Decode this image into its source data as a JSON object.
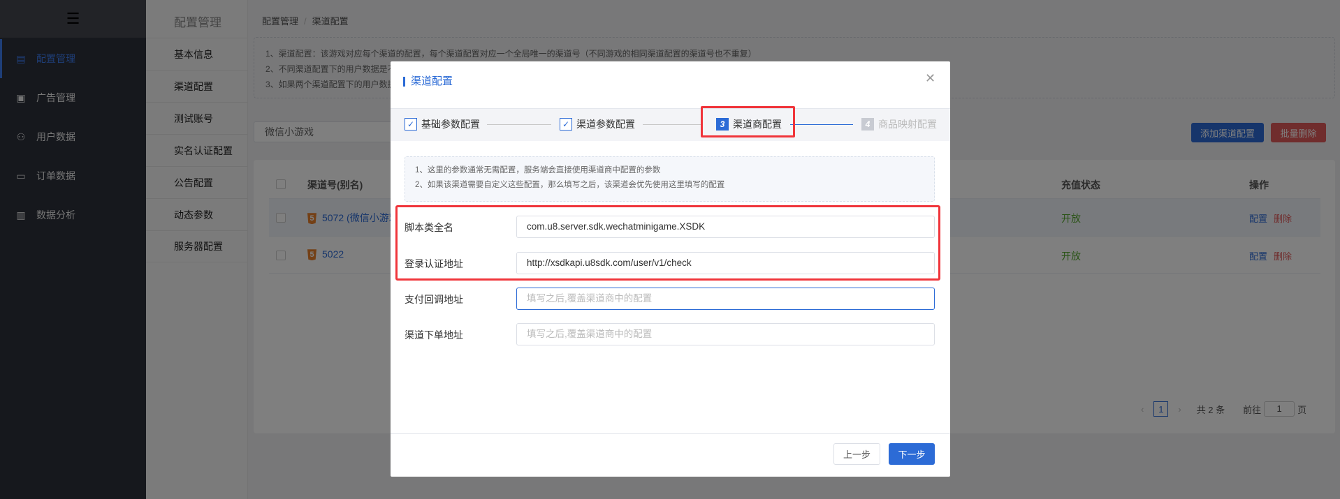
{
  "sidebar": {
    "toggle_icon": "menu-fold-icon",
    "items": [
      {
        "label": "配置管理",
        "icon": "config-icon",
        "active": true
      },
      {
        "label": "广告管理",
        "icon": "ad-icon"
      },
      {
        "label": "用户数据",
        "icon": "users-icon"
      },
      {
        "label": "订单数据",
        "icon": "wallet-icon"
      },
      {
        "label": "数据分析",
        "icon": "bar-chart-icon"
      }
    ]
  },
  "submenu": {
    "title": "配置管理",
    "items": [
      "基本信息",
      "渠道配置",
      "测试账号",
      "实名认证配置",
      "公告配置",
      "动态参数",
      "服务器配置"
    ]
  },
  "breadcrumb": [
    "配置管理",
    "渠道配置"
  ],
  "info": [
    "1、渠道配置：该游戏对应每个渠道的配置，每个渠道配置对应一个全局唯一的渠道号（不同游戏的相同渠道配置的渠道号也不重复）",
    "2、不同渠道配置下的用户数据是不",
    "3、如果两个渠道配置下的用户数据"
  ],
  "game_select": "微信小游戏",
  "toolbar": {
    "add": "添加渠道配置",
    "batch_delete": "批量删除"
  },
  "table": {
    "headers": {
      "channel": "渠道号(别名)",
      "pay_status": "充值状态",
      "actions": "操作"
    },
    "rows": [
      {
        "channel": "5072 (微信小游戏",
        "pay_status": "开放",
        "edit": "配置",
        "delete": "删除"
      },
      {
        "channel": "5022",
        "pay_status": "开放",
        "edit": "配置",
        "delete": "删除"
      }
    ]
  },
  "pagination": {
    "current": "1",
    "total": "共 2 条",
    "goto_label": "前往",
    "goto_value": "1",
    "page_suffix": "页"
  },
  "modal": {
    "title": "渠道配置",
    "steps": [
      {
        "num": "1",
        "label": "基础参数配置",
        "status": "done"
      },
      {
        "num": "2",
        "label": "渠道参数配置",
        "status": "done"
      },
      {
        "num": "3",
        "label": "渠道商配置",
        "status": "current"
      },
      {
        "num": "4",
        "label": "商品映射配置",
        "status": "pending"
      }
    ],
    "notice": [
      "1、这里的参数通常无需配置，服务端会直接使用渠道商中配置的参数",
      "2、如果该渠道需要自定义这些配置，那么填写之后，该渠道会优先使用这里填写的配置"
    ],
    "fields": [
      {
        "label": "脚本类全名",
        "value": "com.u8.server.sdk.wechatminigame.XSDK",
        "placeholder": ""
      },
      {
        "label": "登录认证地址",
        "value": "http://xsdkapi.u8sdk.com/user/v1/check",
        "placeholder": ""
      },
      {
        "label": "支付回调地址",
        "value": "",
        "placeholder": "填写之后,覆盖渠道商中的配置"
      },
      {
        "label": "渠道下单地址",
        "value": "",
        "placeholder": "填写之后,覆盖渠道商中的配置"
      }
    ],
    "prev": "上一步",
    "next": "下一步"
  },
  "colors": {
    "primary": "#2c6bd6",
    "danger": "#e05a5a",
    "success": "#52a62a",
    "highlight": "#f0353b"
  }
}
